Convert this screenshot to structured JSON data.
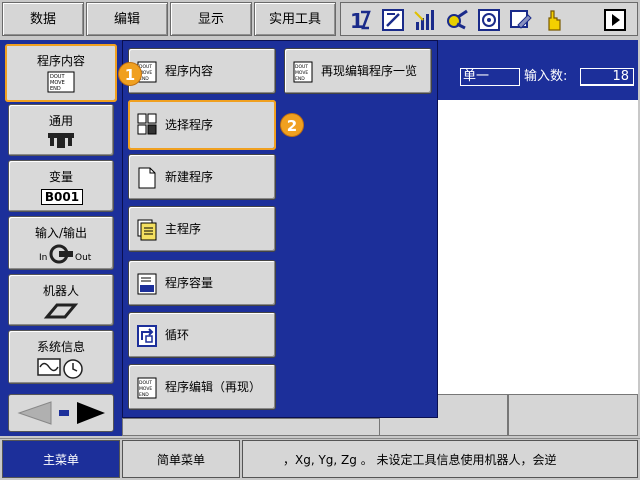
{
  "top_menu": {
    "data": "数据",
    "edit": "编辑",
    "display": "显示",
    "utility": "实用工具"
  },
  "toolbar": {
    "icons": [
      "speed-icon",
      "edit-mode-icon",
      "signal-level-icon",
      "tool-icon",
      "camera-icon",
      "screen-edit-icon",
      "hand-pointer-icon",
      "page-forward-icon"
    ]
  },
  "left_menu": {
    "program_content": {
      "label": "程序内容",
      "icon_text": "DOUT\nMOVE\nEND"
    },
    "general": {
      "label": "通用"
    },
    "variables": {
      "label": "变量",
      "value": "B001"
    },
    "io": {
      "label": "输入/输出",
      "in": "In",
      "out": "Out"
    },
    "robot": {
      "label": "机器人"
    },
    "system_info": {
      "label": "系统信息"
    }
  },
  "submenu": {
    "items": [
      {
        "label": "程序内容"
      },
      {
        "label": "选择程序"
      },
      {
        "label": "新建程序"
      },
      {
        "label": "主程序"
      },
      {
        "label": "程序容量"
      },
      {
        "label": "循环"
      },
      {
        "label": "程序编辑（再现）"
      }
    ],
    "right_item": {
      "label": "再现编辑程序一览"
    }
  },
  "right_panel": {
    "mode": "单一",
    "input_count_label": "输入数:",
    "input_count_value": "18"
  },
  "annotations": {
    "one": "1",
    "two": "2"
  },
  "bottom": {
    "main_menu": "主菜单",
    "simple_menu": "简单菜单",
    "status": "，Xg, Yg, Zg 。   未设定工具信息使用机器人，会逆"
  },
  "colors": {
    "panel_blue": "#1c2f9a",
    "highlight": "#f0a020"
  }
}
